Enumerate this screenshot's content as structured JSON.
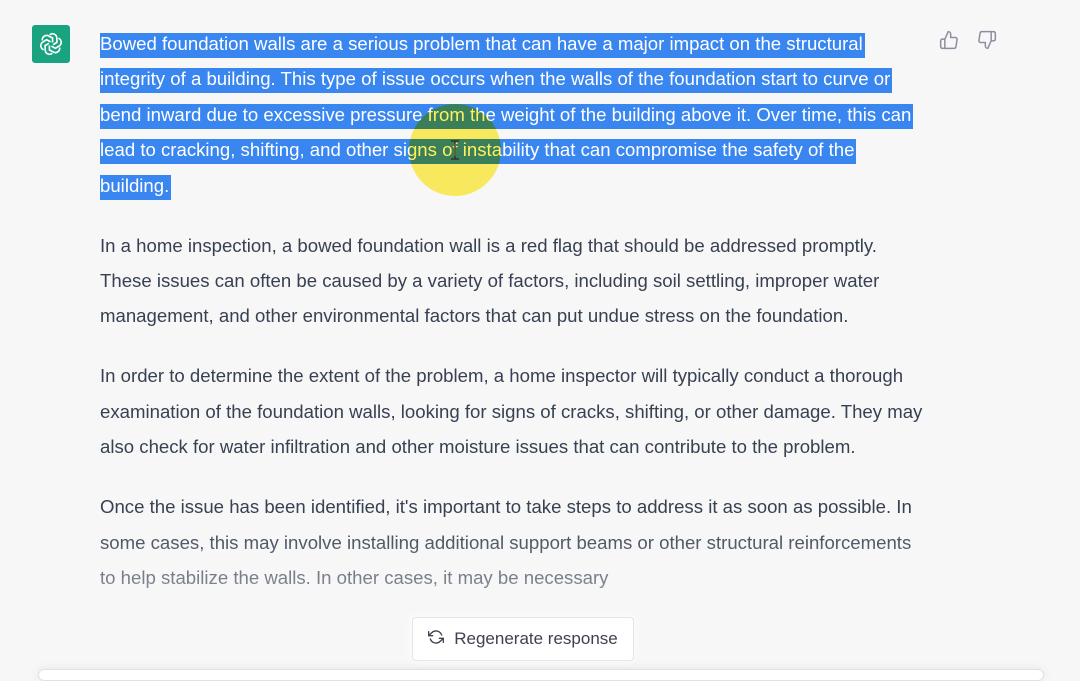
{
  "colors": {
    "background": "#f7f7f8",
    "avatar": "#19a37f",
    "selection": "#3a86f0",
    "text": "#374151",
    "highlighter": "#ffec32"
  },
  "icons": {
    "avatar": "openai-logo-icon",
    "feedback_up": "thumbs-up-icon",
    "feedback_down": "thumbs-down-icon",
    "regenerate": "refresh-icon",
    "cursor": "text-cursor-icon"
  },
  "message": {
    "paragraphs": [
      {
        "selected_text": "Bowed foundation walls are a serious problem that can have a major impact on the structural integrity of a building. This type of issue occurs when the walls of the foundation start to curve or bend inward due to excessive pressure from the weight of the building above it. Over time, this can lead to cracking, shifting, and other signs of instability that can compromise the safety of the building."
      },
      {
        "text": "In a home inspection, a bowed foundation wall is a red flag that should be addressed promptly. These issues can often be caused by a variety of factors, including soil settling, improper water management, and other environmental factors that can put undue stress on the foundation."
      },
      {
        "text": "In order to determine the extent of the problem, a home inspector will typically conduct a thorough examination of the foundation walls, looking for signs of cracks, shifting, or other damage. They may also check for water infiltration and other moisture issues that can contribute to the problem."
      },
      {
        "text": "Once the issue has been identified, it's important to take steps to address it as soon as possible. In some cases, this may involve installing additional support beams or other structural reinforcements to help stabilize the walls. In other cases, it may be necessary"
      }
    ]
  },
  "regenerate": {
    "label": "Regenerate response"
  }
}
